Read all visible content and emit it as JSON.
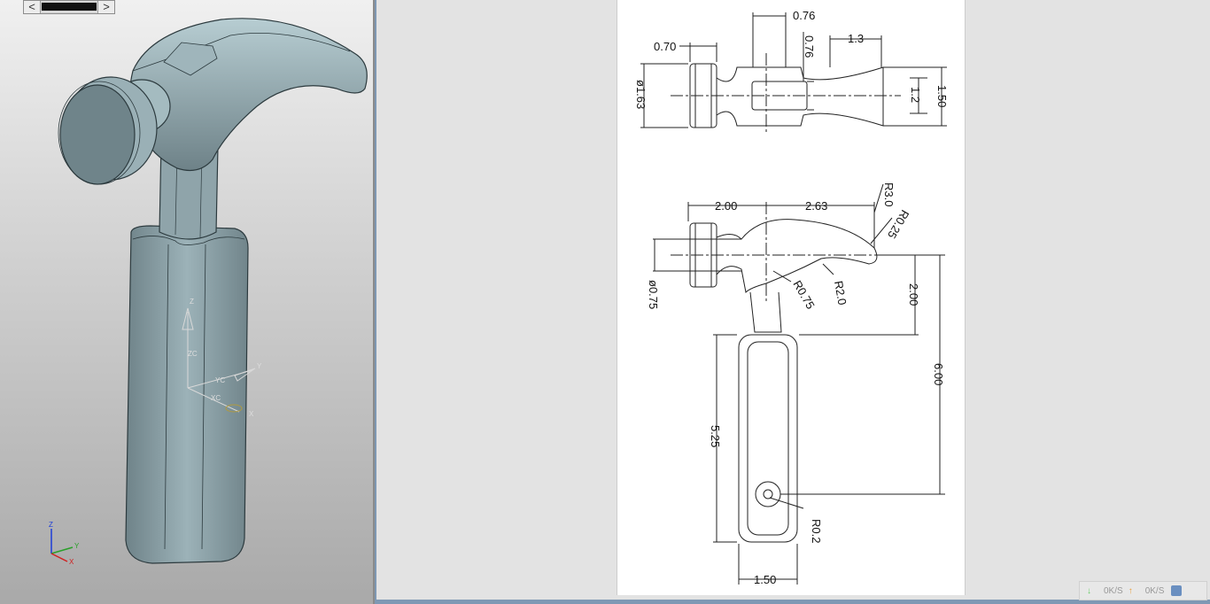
{
  "viewport": {
    "triad": {
      "z": "Z",
      "y": "Y",
      "x": "X"
    },
    "wcs": {
      "z": "Z",
      "zc": "ZC",
      "yc": "YC",
      "y": "Y",
      "xc": "XC",
      "x": "X"
    },
    "scroll_left": "<",
    "scroll_right": ">"
  },
  "drawing": {
    "top_view": [
      "0.76",
      "0.70",
      "0.76",
      "1.3",
      "ø1.63",
      "1.2",
      "1.50"
    ],
    "side_view": [
      "2.00",
      "2.63",
      "R3.0",
      "R0.25",
      "R2.0",
      "R0.75",
      "ø0.75",
      "2.00",
      "6.00",
      "5.25",
      "R0.2",
      "1.50"
    ]
  },
  "netbar": {
    "down": "0K/S",
    "up": "0K/S"
  }
}
